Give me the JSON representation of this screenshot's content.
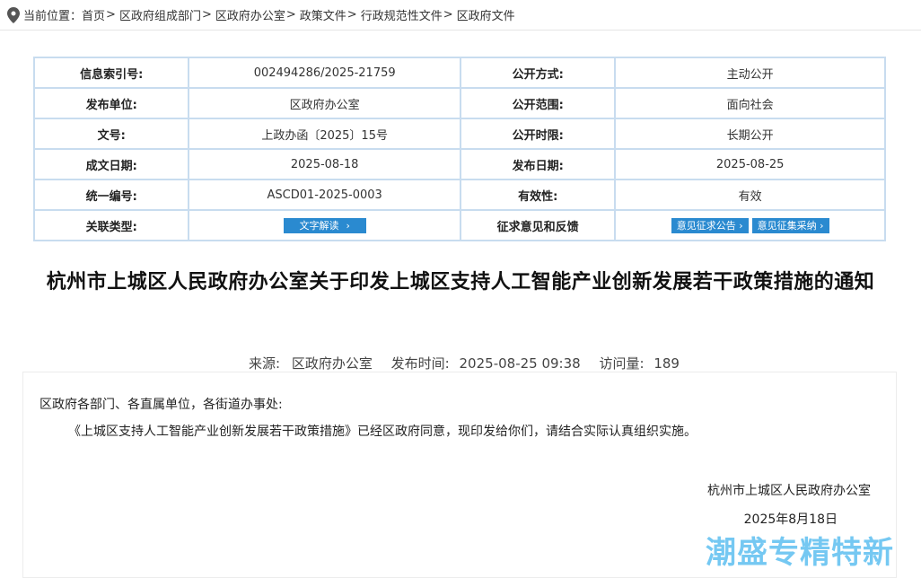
{
  "breadcrumb": {
    "label": "当前位置：",
    "items": [
      "首页",
      "区政府组成部门",
      "区政府办公室",
      "政策文件",
      "行政规范性文件",
      "区政府文件"
    ],
    "sep": ">"
  },
  "info_table": {
    "rows": [
      {
        "l1": "信息索引号:",
        "v1": "002494286/2025-21759",
        "l2": "公开方式:",
        "v2": "主动公开"
      },
      {
        "l1": "发布单位:",
        "v1": "区政府办公室",
        "l2": "公开范围:",
        "v2": "面向社会"
      },
      {
        "l1": "文号:",
        "v1": "上政办函〔2025〕15号",
        "l2": "公开时限:",
        "v2": "长期公开"
      },
      {
        "l1": "成文日期:",
        "v1": "2025-08-18",
        "l2": "发布日期:",
        "v2": "2025-08-25"
      },
      {
        "l1": "统一编号:",
        "v1": "ASCD01-2025-0003",
        "l2": "有效性:",
        "v2": "有效"
      },
      {
        "l1": "关联类型:",
        "v1": "",
        "l2": "征求意见和反馈",
        "v2": ""
      }
    ],
    "btn_interpret": "文字解读",
    "btn_opinion_notice": "意见征求公告",
    "btn_opinion_adopt": "意见征集采纳",
    "arrow": "›"
  },
  "article": {
    "title": "杭州市上城区人民政府办公室关于印发上城区支持人工智能产业创新发展若干政策措施的通知",
    "source_label": "来源:",
    "source": "区政府办公室",
    "time_label": "发布时间:",
    "time": "2025-08-25 09:38",
    "views_label": "访问量:",
    "views": "189",
    "salutation": "区政府各部门、各直属单位，各街道办事处:",
    "paragraph": "《上城区支持人工智能产业创新发展若干政策措施》已经区政府同意，现印发给你们，请结合实际认真组织实施。",
    "sign_org": "杭州市上城区人民政府办公室",
    "sign_date": "2025年8月18日"
  },
  "watermark": "潮盛专精特新",
  "colors": {
    "table_border": "#c8dcef",
    "button_blue": "#2a8ad0",
    "watermark": "#6ec6f2"
  },
  "icons": {
    "location": "map-pin-icon"
  }
}
